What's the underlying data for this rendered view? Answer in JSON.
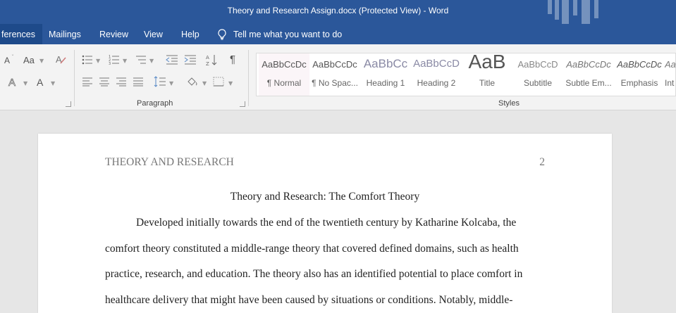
{
  "window": {
    "title": "Theory and Research Assign.docx (Protected View)  -  Word"
  },
  "tabs": [
    {
      "label": "ferences",
      "active": true
    },
    {
      "label": "Mailings"
    },
    {
      "label": "Review"
    },
    {
      "label": "View"
    },
    {
      "label": "Help"
    }
  ],
  "tellme": {
    "text": "Tell me what you want to do"
  },
  "ribbon": {
    "font_group": {
      "grow": "A",
      "case": "Aa",
      "color_a": "A"
    },
    "paragraph_group": {
      "label": "Paragraph",
      "pilcrow": "¶"
    },
    "styles_group": {
      "label": "Styles"
    },
    "styles": [
      {
        "preview": "AaBbCcDc",
        "name": "¶ Normal"
      },
      {
        "preview": "AaBbCcDc",
        "name": "¶ No Spac..."
      },
      {
        "preview": "AaBbCc",
        "name": "Heading 1"
      },
      {
        "preview": "AaBbCcD",
        "name": "Heading 2"
      },
      {
        "preview": "AaB",
        "name": "Title"
      },
      {
        "preview": "AaBbCcD",
        "name": "Subtitle"
      },
      {
        "preview": "AaBbCcDc",
        "name": "Subtle Em..."
      },
      {
        "preview": "AaBbCcDc",
        "name": "Emphasis"
      },
      {
        "preview": "AaBbCcDc",
        "name": "Int"
      }
    ]
  },
  "document": {
    "header_left": "THEORY AND RESEARCH",
    "page_number": "2",
    "title": "Theory and Research: The Comfort Theory",
    "lines": [
      "Developed initially towards the end of the twentieth century by Katharine Kolcaba, the",
      "comfort theory constituted a middle-range theory that covered defined domains, such as health",
      "practice, research, and education. The theory also has an identified potential to place comfort in",
      "healthcare delivery that might have been caused by situations or conditions. Notably, middle-"
    ]
  }
}
